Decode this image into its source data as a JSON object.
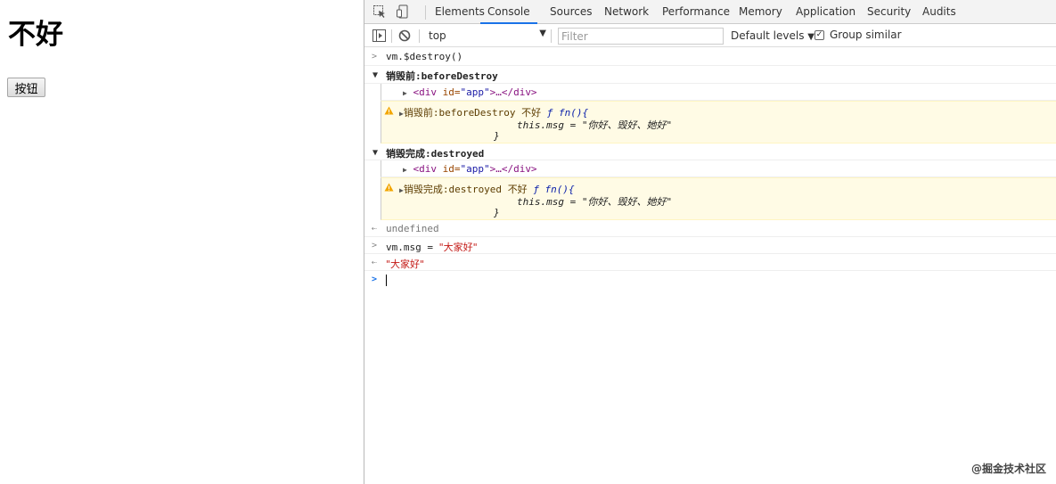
{
  "page": {
    "heading": "不好",
    "button_label": "按钮"
  },
  "devtools": {
    "tabs": [
      "Elements",
      "Console",
      "Sources",
      "Network",
      "Performance",
      "Memory",
      "Application",
      "Security",
      "Audits"
    ],
    "active_tab": "Console",
    "toolbar": {
      "context": "top",
      "filter_placeholder": "Filter",
      "levels": "Default levels",
      "group_similar": "Group similar",
      "group_similar_checked": true
    },
    "console": {
      "cmd1": "vm.$destroy()",
      "group1": {
        "label_cn": "销毁前",
        "label_rest": ":beforeDestroy"
      },
      "el1": {
        "open": "<div",
        "attr": " id=",
        "val": "\"app\"",
        "close": ">…</div>"
      },
      "warn1": {
        "prefix_cn": "销毁前",
        "rest": ":beforeDestroy ",
        "msg_cn": "不好",
        "fn_head": "ƒ fn(){",
        "body_pre": "this.msg = \"",
        "body_cn": "你好、毁好、她好",
        "body_post": "\"",
        "close": "}"
      },
      "group2": {
        "label_cn": "销毁完成",
        "label_rest": ":destroyed"
      },
      "el2": {
        "open": "<div",
        "attr": " id=",
        "val": "\"app\"",
        "close": ">…</div>"
      },
      "warn2": {
        "prefix_cn": "销毁完成",
        "rest": ":destroyed ",
        "msg_cn": "不好",
        "fn_head": "ƒ fn(){",
        "body_pre": "this.msg = \"",
        "body_cn": "你好、毁好、她好",
        "body_post": "\"",
        "close": "}"
      },
      "result1": "undefined",
      "cmd2_pre": "vm.msg = ",
      "cmd2_str": "\"大家好\"",
      "result2": "\"大家好\""
    }
  },
  "watermark": "@掘金技术社区",
  "colors": {
    "active_tab_underline": "#1a73e8",
    "warning_bg": "#fffbe5",
    "string": "#c41a16"
  }
}
